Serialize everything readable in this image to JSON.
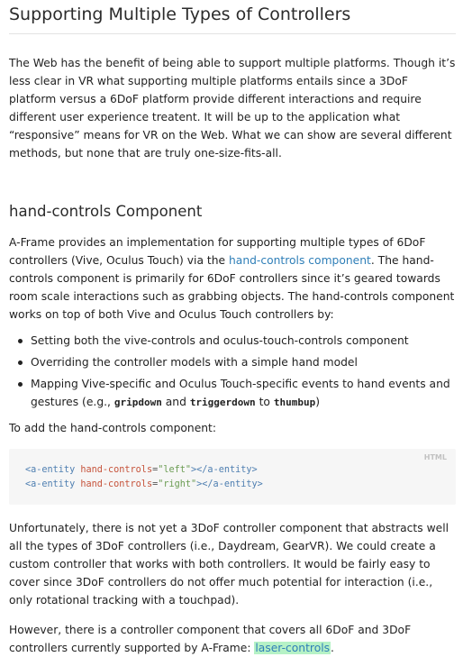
{
  "section1": {
    "title": "Supporting Multiple Types of Controllers",
    "paragraph": "The Web has the benefit of being able to support multiple platforms. Though it’s less clear in VR what supporting multiple platforms entails since a 3DoF platform versus a 6DoF platform provide different interactions and require different user experience treatent. It will be up to the application what “responsive” means for VR on the Web. What we can show are several different methods, but none that are truly one-size-fits-all."
  },
  "section2": {
    "title": "hand-controls Component",
    "p1_before": "A-Frame provides an implementation for supporting multiple types of 6DoF controllers (Vive, Oculus Touch) via the ",
    "p1_link": "hand-controls component",
    "p1_after": ". The hand-controls component is primarily for 6DoF controllers since it’s geared towards room scale interactions such as grabbing objects. The hand-controls component works on top of both Vive and Oculus Touch controllers by:",
    "bullets": [
      "Setting both the vive-controls and oculus-touch-controls component",
      "Overriding the controller models with a simple hand model"
    ],
    "bullet3": {
      "before": "Mapping Vive-specific and Oculus Touch-specific events to hand events and gestures (e.g., ",
      "code1": "gripdown",
      "and": " and ",
      "code2": "triggerdown",
      "to": " to ",
      "code3": "thumbup",
      "after": ")"
    },
    "p_add": "To add the hand-controls component:",
    "code": {
      "lang": "HTML",
      "line1": {
        "open": "<a-entity",
        "attr": "hand-controls",
        "eq": "=",
        "val": "\"left\"",
        "close": "></a-entity>"
      },
      "line2": {
        "open": "<a-entity",
        "attr": "hand-controls",
        "eq": "=",
        "val": "\"right\"",
        "close": "></a-entity>"
      }
    },
    "p_unfortunately": "Unfortunately, there is not yet a 3DoF controller component that abstracts well all the types of 3DoF controllers (i.e., Daydream, GearVR). We could create a custom controller that works with both controllers. It would be fairly easy to cover since 3DoF controllers do not offer much potential for interaction (i.e., only rotational tracking with a touchpad).",
    "p_however_before": "However, there is a controller component that covers all 6DoF and 3DoF controllers currently supported by A-Frame: ",
    "p_however_link": "laser-controls",
    "p_however_after": "."
  }
}
